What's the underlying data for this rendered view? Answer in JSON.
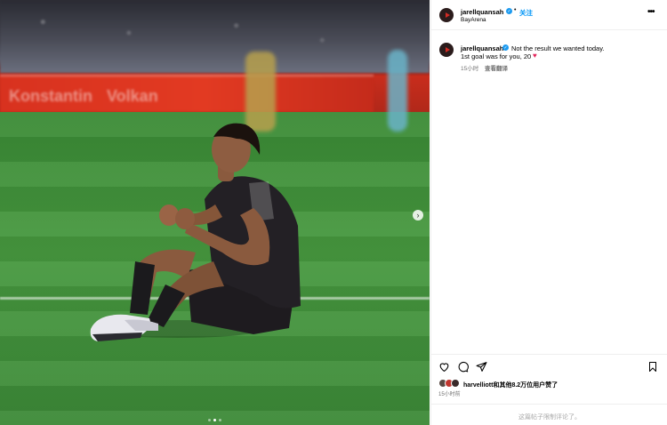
{
  "post": {
    "username": "jarellquansah",
    "follow_label": "关注",
    "location": "BayArena",
    "header_separator": "•",
    "more_label": "•••",
    "caption_line1": "Not the result we wanted today.",
    "caption_line2": "1st goal was for you, 20",
    "caption_emoji": "♥",
    "caption_time": "15小时",
    "translate_label": "查看翻译",
    "likes_text": "harvelliott和其他8.2万位用户赞了",
    "post_time": "15小时前",
    "comments_disabled": "这篇帖子限制评论了。"
  },
  "media": {
    "ad_board_texts": [
      "Konstantin",
      "Volkan"
    ],
    "carousel_dot_count": 3,
    "carousel_active_index": 1,
    "next_arrow": "›"
  },
  "icons": {
    "verified": "verified-badge-icon",
    "like": "heart-outline-icon",
    "comment": "comment-bubble-icon",
    "share": "paper-plane-icon",
    "save": "bookmark-icon"
  },
  "colors": {
    "follow_blue": "#0095f6",
    "verified_blue": "#1d9bf0",
    "heart_red": "#e3245a"
  }
}
